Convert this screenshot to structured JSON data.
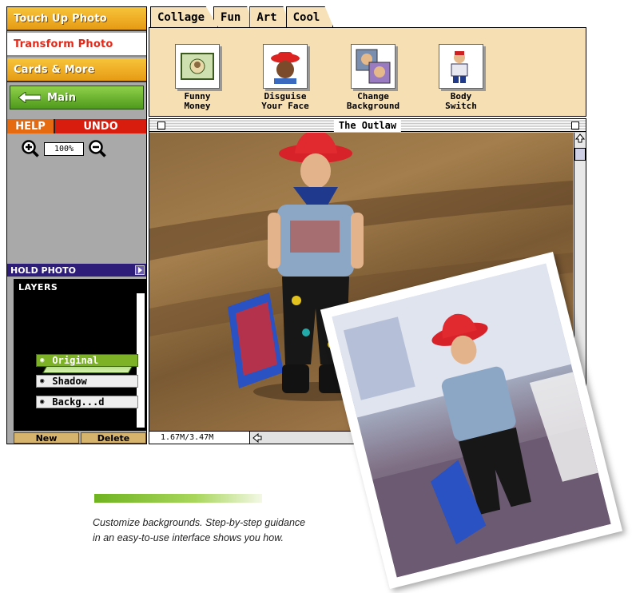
{
  "sidebar": {
    "nav": {
      "touch_up": "Touch Up Photo",
      "transform": "Transform Photo",
      "cards": "Cards & More",
      "main": "Main"
    },
    "help_label": "HELP",
    "undo_label": "UNDO",
    "zoom_value": "100%",
    "hold_photo_label": "HOLD PHOTO",
    "layers_title": "LAYERS",
    "layers": [
      {
        "name": "Original",
        "selected": true
      },
      {
        "name": "Shadow",
        "selected": false
      },
      {
        "name": "Backg...d",
        "selected": false
      }
    ],
    "new_label": "New",
    "delete_label": "Delete"
  },
  "tabs": [
    "Collage",
    "Fun",
    "Art",
    "Cool"
  ],
  "active_tab": "Collage",
  "tools": [
    {
      "label_line1": "Funny",
      "label_line2": "Money",
      "icon": "money-icon"
    },
    {
      "label_line1": "Disguise",
      "label_line2": "Your Face",
      "icon": "disguise-face-icon"
    },
    {
      "label_line1": "Change",
      "label_line2": "Background",
      "icon": "change-background-icon"
    },
    {
      "label_line1": "Body",
      "label_line2": "Switch",
      "icon": "body-switch-icon"
    }
  ],
  "image_window": {
    "title": "The Outlaw",
    "memory": "1.67M/3.47M"
  },
  "caption": {
    "line1": "Customize backgrounds. Step-by-step guidance",
    "line2": "in an easy-to-use interface shows you how."
  },
  "colors": {
    "nav_orange": "#e69b14",
    "nav_green": "#4f9a1c",
    "undo_red": "#d81d0f",
    "help_orange": "#e56a10",
    "hold_photo_purple": "#2e1e7a",
    "panel_tan": "#f6dfb3",
    "layer_selected_green": "#7db227"
  }
}
